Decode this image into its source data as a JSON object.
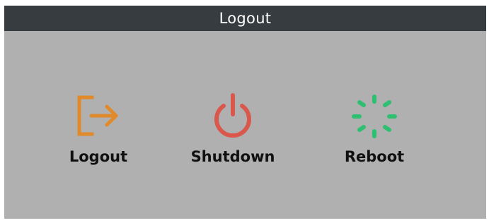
{
  "window": {
    "title": "Logout"
  },
  "options": [
    {
      "label": "Logout",
      "icon": "logout-icon",
      "color": "#e08a2c"
    },
    {
      "label": "Shutdown",
      "icon": "power-icon",
      "color": "#d9574b"
    },
    {
      "label": "Reboot",
      "icon": "reboot-spinner-icon",
      "color": "#2fbf71"
    }
  ]
}
